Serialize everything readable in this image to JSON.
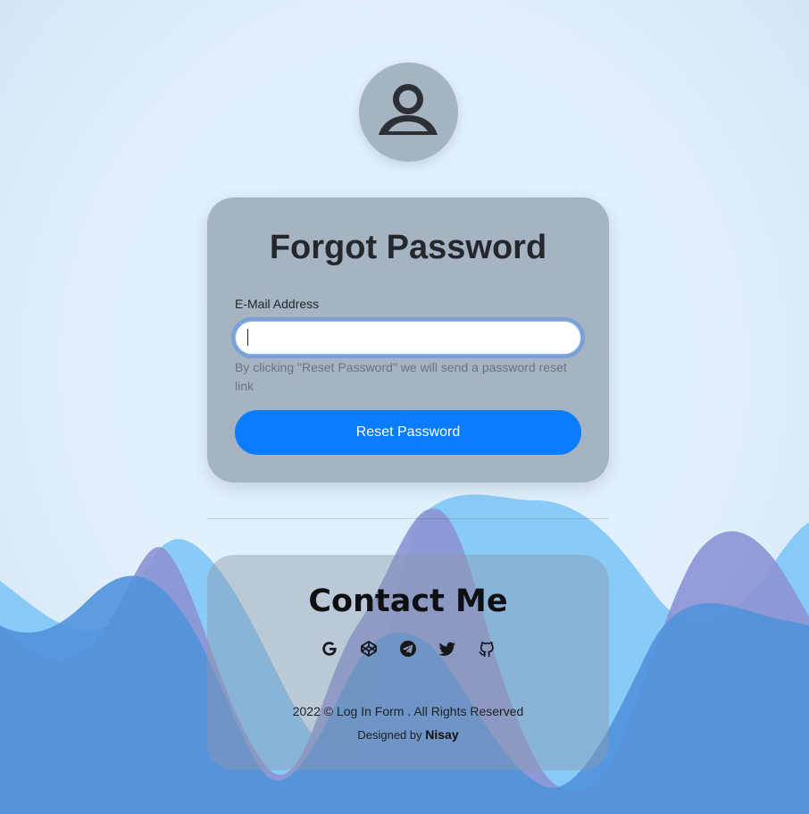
{
  "form": {
    "title": "Forgot Password",
    "email_label": "E-Mail Address",
    "email_value": "",
    "email_placeholder": "",
    "hint": "By clicking \"Reset Password\" we will send a password reset link",
    "submit_label": "Reset Password"
  },
  "contact": {
    "title": "Contact Me",
    "links": [
      {
        "icon": "google-icon"
      },
      {
        "icon": "codepen-icon"
      },
      {
        "icon": "telegram-icon"
      },
      {
        "icon": "twitter-icon"
      },
      {
        "icon": "github-icon"
      }
    ]
  },
  "footer": {
    "copyright": "2022 © Log In Form . All Rights Reserved",
    "designed_prefix": "Designed by",
    "designer": "Nisay"
  },
  "colors": {
    "primary": "#0a7cff",
    "card": "#a6b3c3",
    "wave_light": "#84c8f7",
    "wave_purple": "#8c94d3",
    "wave_blue": "#5192dc"
  }
}
